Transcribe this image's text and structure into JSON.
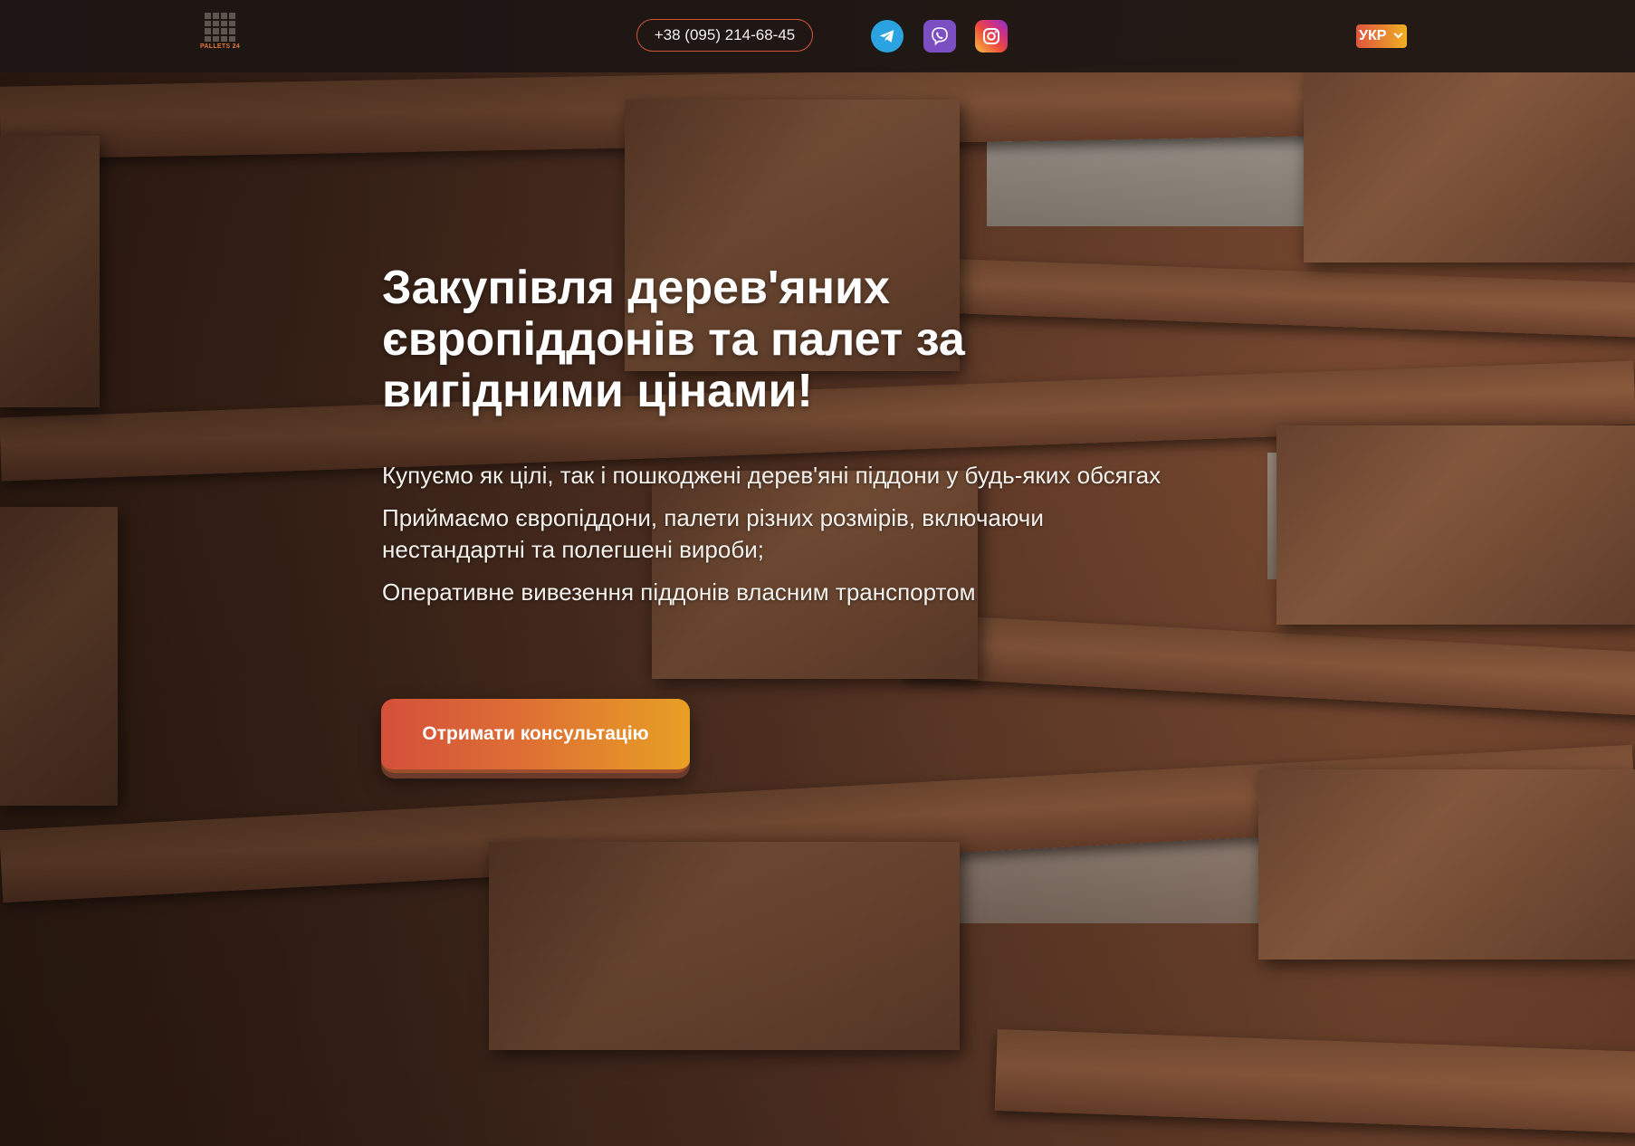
{
  "header": {
    "logo_text": "PALLETS 24",
    "phone": "+38 (095) 214-68-45",
    "socials": [
      {
        "name": "telegram",
        "icon": "telegram-icon",
        "color": "#2aa3e0"
      },
      {
        "name": "viber",
        "icon": "viber-icon",
        "color": "#7b4fc2"
      },
      {
        "name": "instagram",
        "icon": "instagram-icon",
        "color": "#ee4a3d"
      }
    ],
    "language": "УКР"
  },
  "hero": {
    "title": "Закупівля дерев'яних європіддонів та палет за вигідними цінами!",
    "bullets": [
      "Купуємо як цілі, так і пошкоджені дерев'яні піддони у будь-яких обсягах",
      "Приймаємо європіддони, палети різних розмірів, включаючи нестандартні та полегшені вироби;",
      "Оперативне вивезення піддонів власним транспортом"
    ],
    "cta_label": "Отримати консультацію"
  },
  "colors": {
    "accent_start": "#d4503a",
    "accent_end": "#e8a024",
    "header_bg": "#1c1614"
  }
}
